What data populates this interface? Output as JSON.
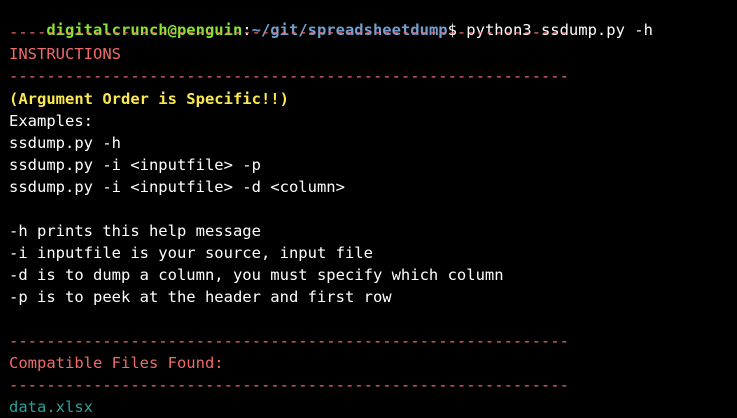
{
  "prompt": {
    "user_host": "digitalcrunch@penguin",
    "colon": ":",
    "path": "~/git/spreadsheetdump",
    "dollar": "$",
    "command": " python3 ssdump.py -h"
  },
  "separator": "------------------------------------------------------------",
  "instructions_heading": "INSTRUCTIONS",
  "warning": "(Argument Order is Specific!!)",
  "examples_label": "Examples:",
  "examples": [
    "ssdump.py -h",
    "ssdump.py -i <inputfile> -p",
    "ssdump.py -i <inputfile> -d <column>"
  ],
  "help_lines": [
    "-h prints this help message",
    "-i inputfile is your source, input file",
    "-d is to dump a column, you must specify which column",
    "-p is to peek at the header and first row"
  ],
  "compatible_heading": "Compatible Files Found:",
  "files": [
    "data.xlsx"
  ],
  "colors": {
    "background": "#000000",
    "user_host": "#8ae234",
    "path": "#729fcf",
    "heading": "#ef6b6b",
    "warning": "#fce94f",
    "file": "#2aa198"
  }
}
